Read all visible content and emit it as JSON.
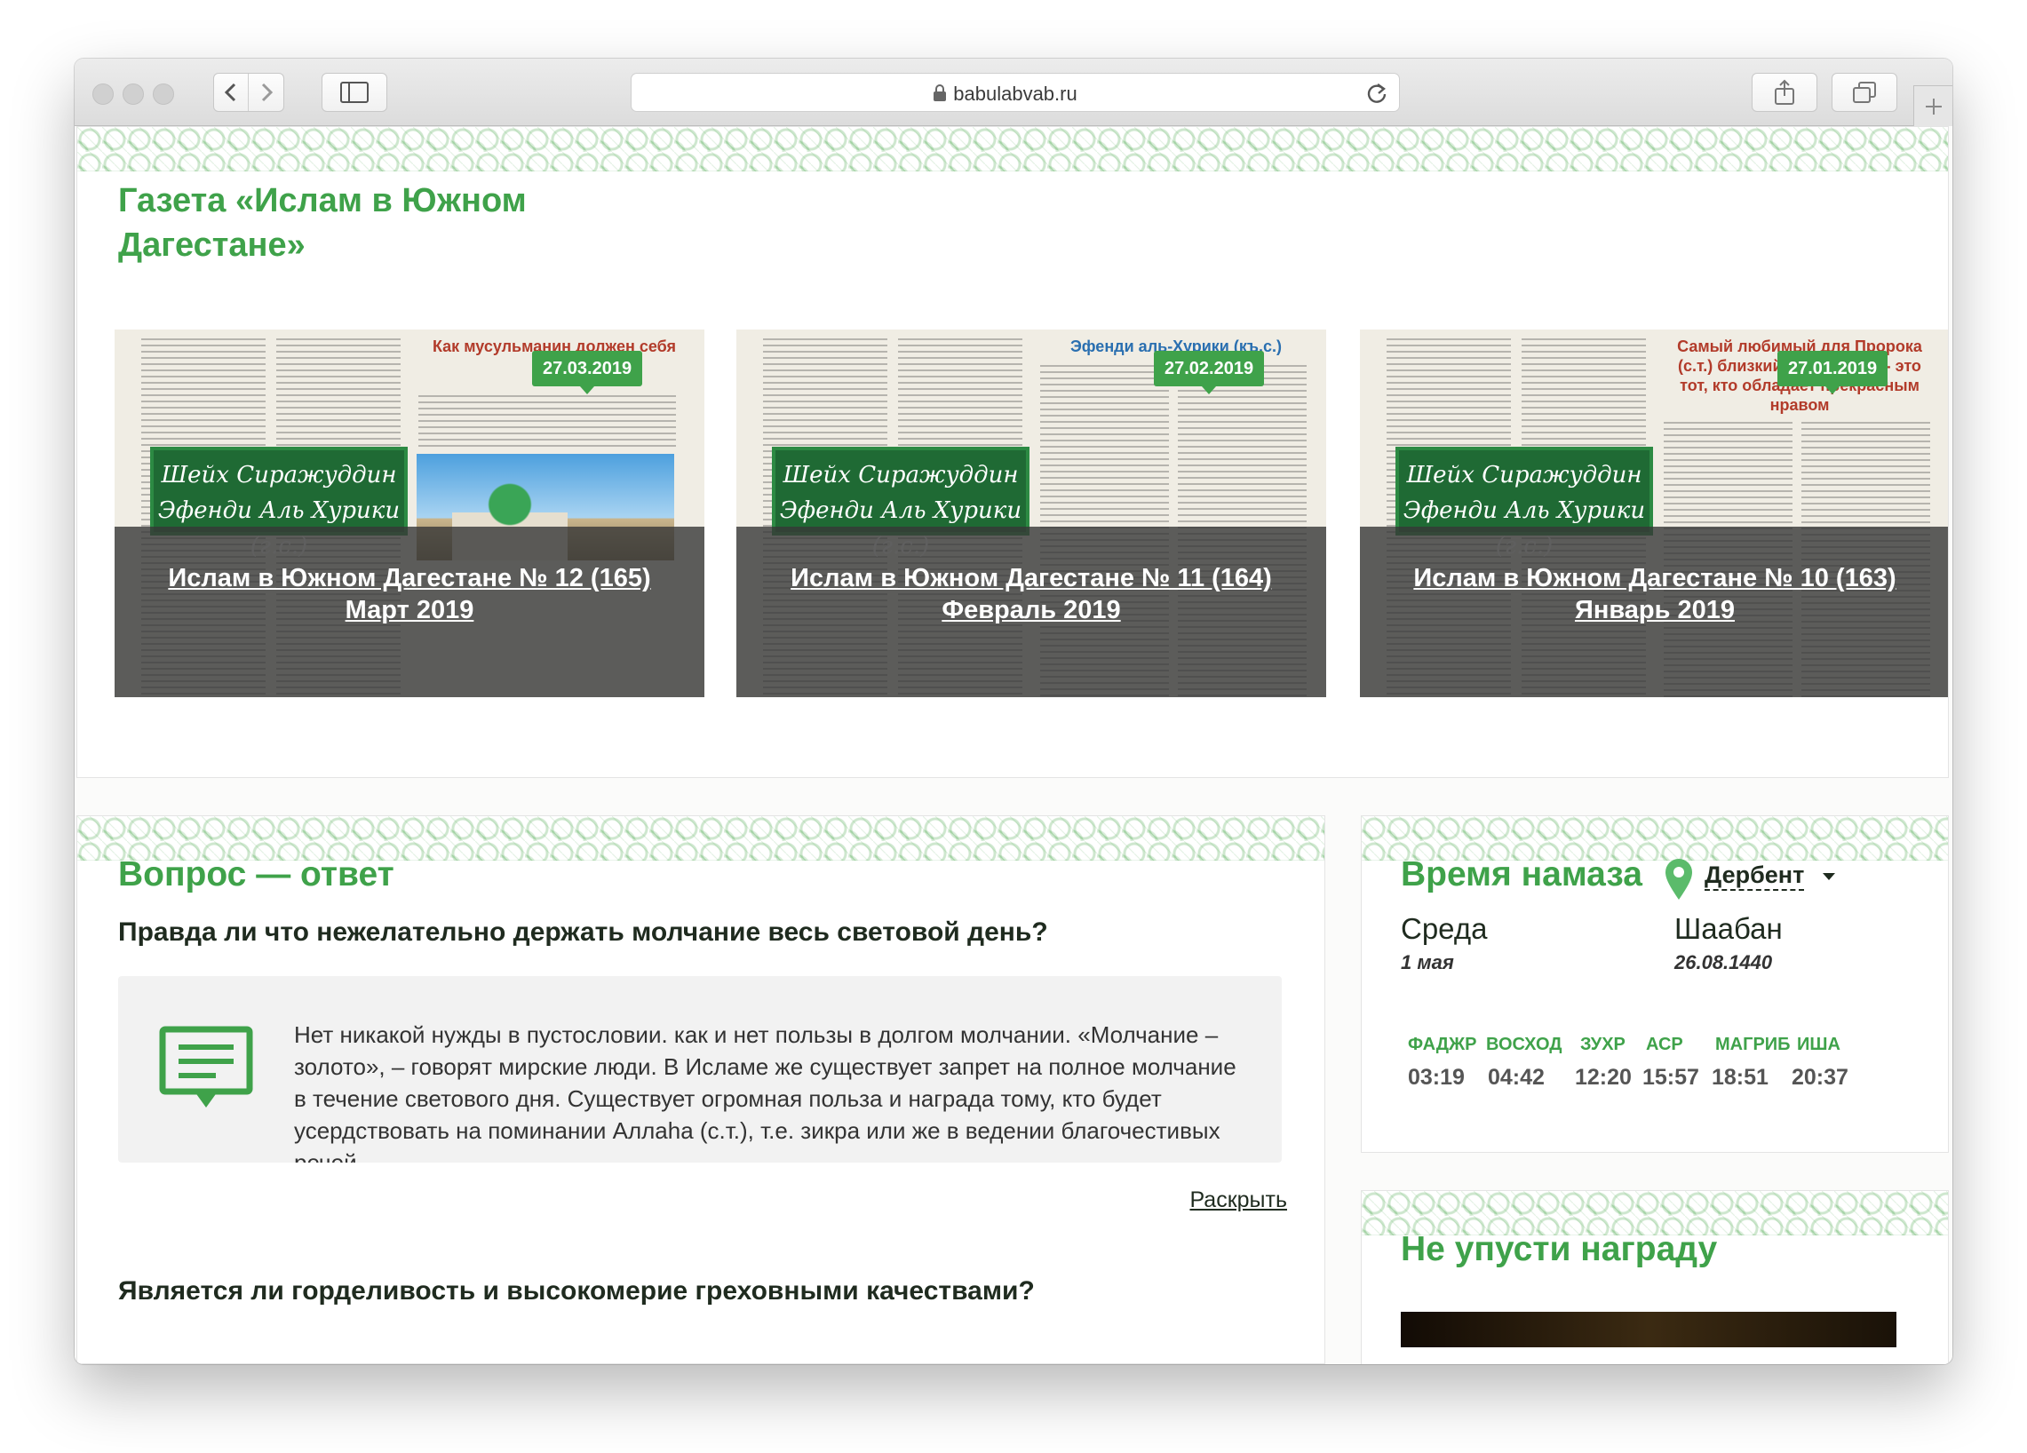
{
  "browser": {
    "url": "babulabvab.ru"
  },
  "newspaper": {
    "title": "Газета «Ислам в Южном Дагестане»",
    "issues": [
      {
        "date": "27.03.2019",
        "caption_line1": "Ислам в Южном Дагестане № 12 (165)",
        "caption_line2": "Март 2019",
        "banner": "Шейх Сиражуддин Эфенди Аль Хурики (г.с.)",
        "headline": "Как мусульманин должен себя вести"
      },
      {
        "date": "27.02.2019",
        "caption_line1": "Ислам в Южном Дагестане № 11 (164)",
        "caption_line2": "Февраль 2019",
        "banner": "Шейх Сиражуддин Эфенди Аль Хурики (г.с.)",
        "headline": "Эфенди аль-Хурики (къ.с.)"
      },
      {
        "date": "27.01.2019",
        "caption_line1": "Ислам в Южном Дагестане № 10 (163)",
        "caption_line2": "Январь 2019",
        "banner": "Шейх Сиражуддин Эфенди Аль Хурики (г.с.)",
        "headline": "Самый любимый для Пророка (с.т.) близкий к нему день - это тот, кто обладает прекрасным нравом"
      }
    ]
  },
  "qa": {
    "title": "Вопрос — ответ",
    "question1": "Правда ли что нежелательно держать молчание весь световой день?",
    "answer": "Нет никакой нужды в пустословии. как и нет пользы в долгом молчании. «Молчание – золото», – говорят мирские люди. В Исламе же существует запрет на полное молчание в течение светового дня. Существует огромная польза и награда тому, кто будет усердствовать на поминании Аллаhа (с.т.), т.е. зикра или же в ведении благочестивых речей",
    "expand_label": "Раскрыть",
    "question2": "Является ли горделивость и высокомерие греховными качествами?"
  },
  "prayer": {
    "title": "Время намаза",
    "city": "Дербент",
    "weekday": "Среда",
    "date": "1 мая",
    "hijri_month": "Шаабан",
    "hijri_date": "26.08.1440",
    "times": [
      {
        "name": "ФАДЖР",
        "time": "03:19"
      },
      {
        "name": "ВОСХОД",
        "time": "04:42"
      },
      {
        "name": "ЗУХР",
        "time": "12:20"
      },
      {
        "name": "АСР",
        "time": "15:57"
      },
      {
        "name": "МАГРИБ",
        "time": "18:51"
      },
      {
        "name": "ИША",
        "time": "20:37"
      }
    ]
  },
  "reward": {
    "title": "Не упусти награду"
  },
  "colors": {
    "accent": "#3fa24a",
    "text": "#1f2b1f",
    "overlay": "#373737"
  },
  "icons": [
    "back-icon",
    "forward-icon",
    "sidebar-icon",
    "lock-icon",
    "reload-icon",
    "share-icon",
    "tabs-icon",
    "plus-icon",
    "message-icon",
    "location-pin-icon"
  ]
}
